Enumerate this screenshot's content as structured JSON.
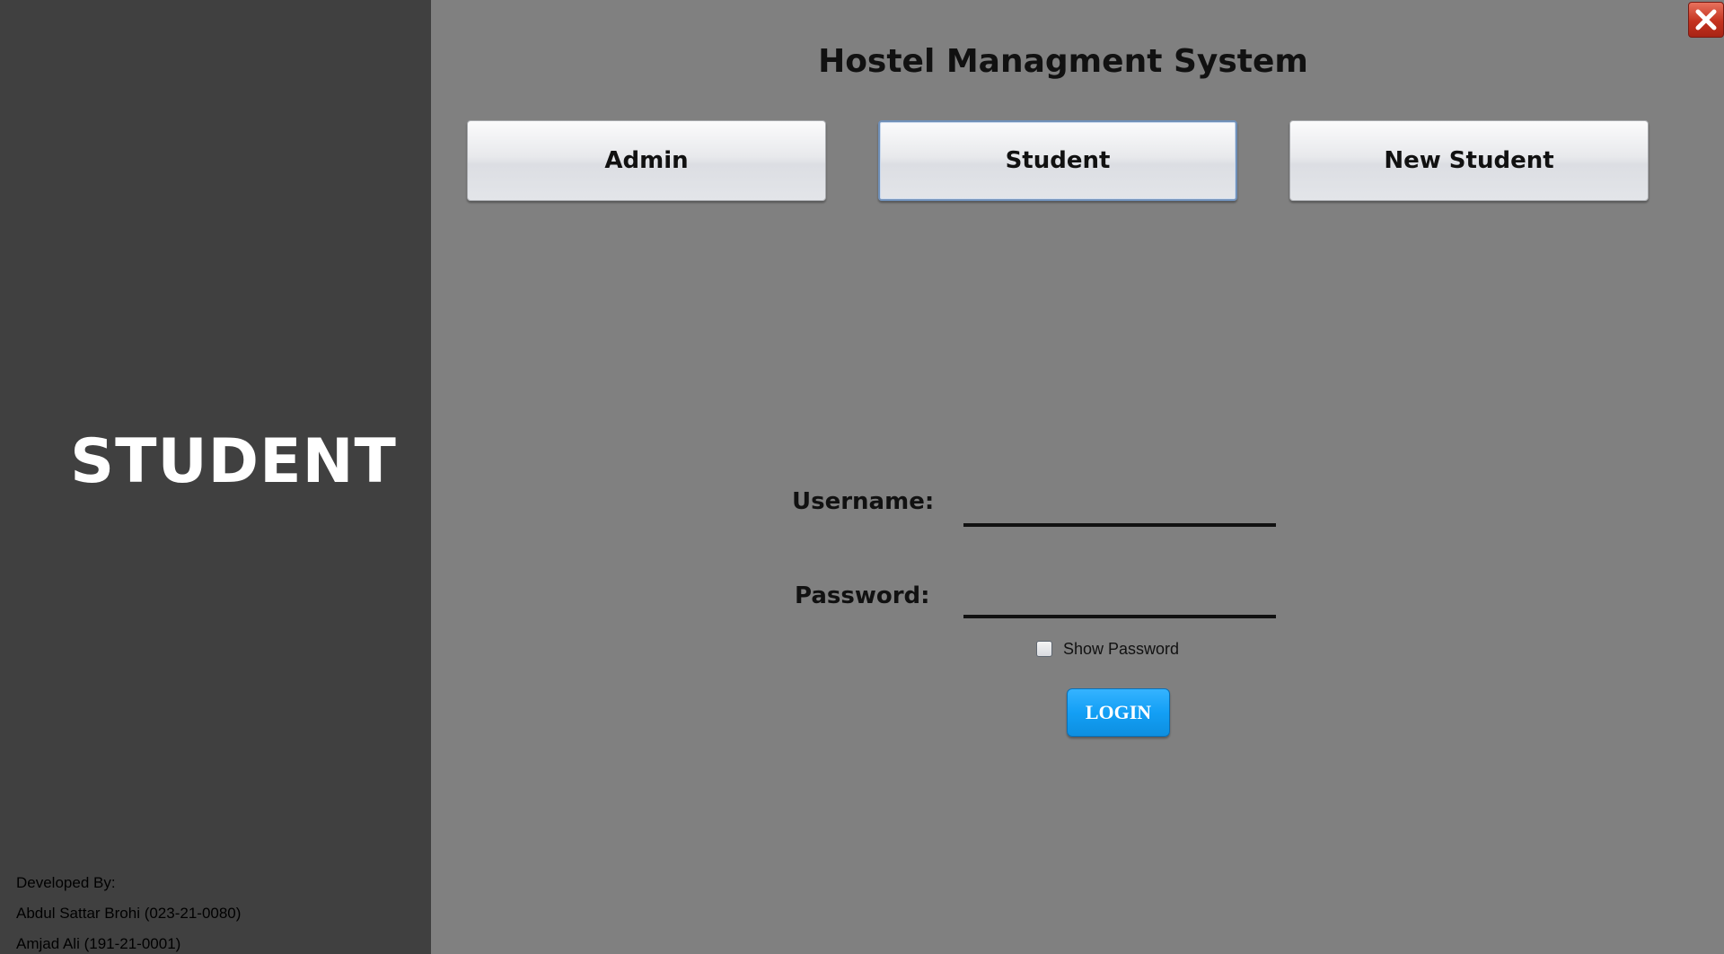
{
  "sidebar": {
    "title": "STUDENT",
    "credits": {
      "heading": "Developed By:",
      "developers": [
        "Abdul Sattar Brohi (023-21-0080)",
        "Amjad Ali (191-21-0001)"
      ]
    }
  },
  "header": {
    "title": "Hostel Managment System"
  },
  "roles": {
    "admin_label": "Admin",
    "student_label": "Student",
    "new_student_label": "New Student",
    "selected": "Student"
  },
  "login_form": {
    "username_label": "Username:",
    "username_value": "",
    "password_label": "Password:",
    "password_value": "",
    "show_password_label": "Show Password",
    "show_password_checked": false,
    "login_label": "LOGIN"
  },
  "window": {
    "close_icon": "close-icon"
  },
  "colors": {
    "sidebar_bg": "#404040",
    "main_bg": "#808080",
    "login_button": "#139ff5",
    "close_button": "#c4321f"
  }
}
